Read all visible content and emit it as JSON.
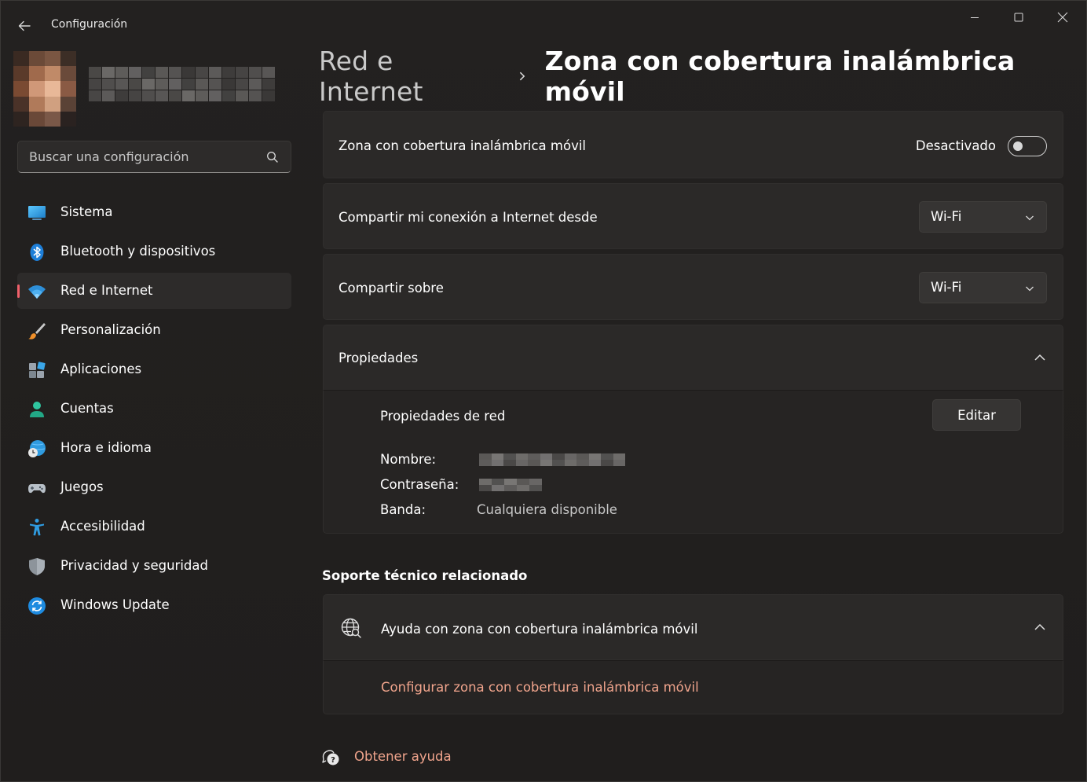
{
  "window": {
    "title": "Configuración"
  },
  "search": {
    "placeholder": "Buscar una configuración"
  },
  "sidebar": {
    "items": [
      {
        "label": "Sistema",
        "icon": "system-display-icon",
        "active": false
      },
      {
        "label": "Bluetooth y dispositivos",
        "icon": "bluetooth-icon",
        "active": false
      },
      {
        "label": "Red e Internet",
        "icon": "wifi-icon",
        "active": true
      },
      {
        "label": "Personalización",
        "icon": "paintbrush-icon",
        "active": false
      },
      {
        "label": "Aplicaciones",
        "icon": "apps-icon",
        "active": false
      },
      {
        "label": "Cuentas",
        "icon": "account-icon",
        "active": false
      },
      {
        "label": "Hora e idioma",
        "icon": "time-language-icon",
        "active": false
      },
      {
        "label": "Juegos",
        "icon": "gamepad-icon",
        "active": false
      },
      {
        "label": "Accesibilidad",
        "icon": "accessibility-icon",
        "active": false
      },
      {
        "label": "Privacidad y seguridad",
        "icon": "shield-icon",
        "active": false
      },
      {
        "label": "Windows Update",
        "icon": "update-icon",
        "active": false
      }
    ]
  },
  "breadcrumb": {
    "parent": "Red e Internet",
    "current": "Zona con cobertura inalámbrica móvil"
  },
  "hotspot": {
    "label": "Zona con cobertura inalámbrica móvil",
    "toggle_state": "Desactivado"
  },
  "share_from": {
    "label": "Compartir mi conexión a Internet desde",
    "value": "Wi-Fi"
  },
  "share_over": {
    "label": "Compartir sobre",
    "value": "Wi-Fi"
  },
  "properties": {
    "label": "Propiedades",
    "network_properties": "Propiedades de red",
    "edit_label": "Editar",
    "name_label": "Nombre:",
    "password_label": "Contraseña:",
    "band_label": "Banda:",
    "band_value": "Cualquiera disponible"
  },
  "related_support": {
    "title": "Soporte técnico relacionado",
    "help_label": "Ayuda con zona con cobertura inalámbrica móvil",
    "link": "Configurar zona con cobertura inalámbrica móvil"
  },
  "get_help": {
    "label": "Obtener ayuda"
  },
  "colors": {
    "accent": "#f0606a",
    "link": "#f0a48c",
    "card": "#2b2928",
    "background": "#201e1d"
  }
}
